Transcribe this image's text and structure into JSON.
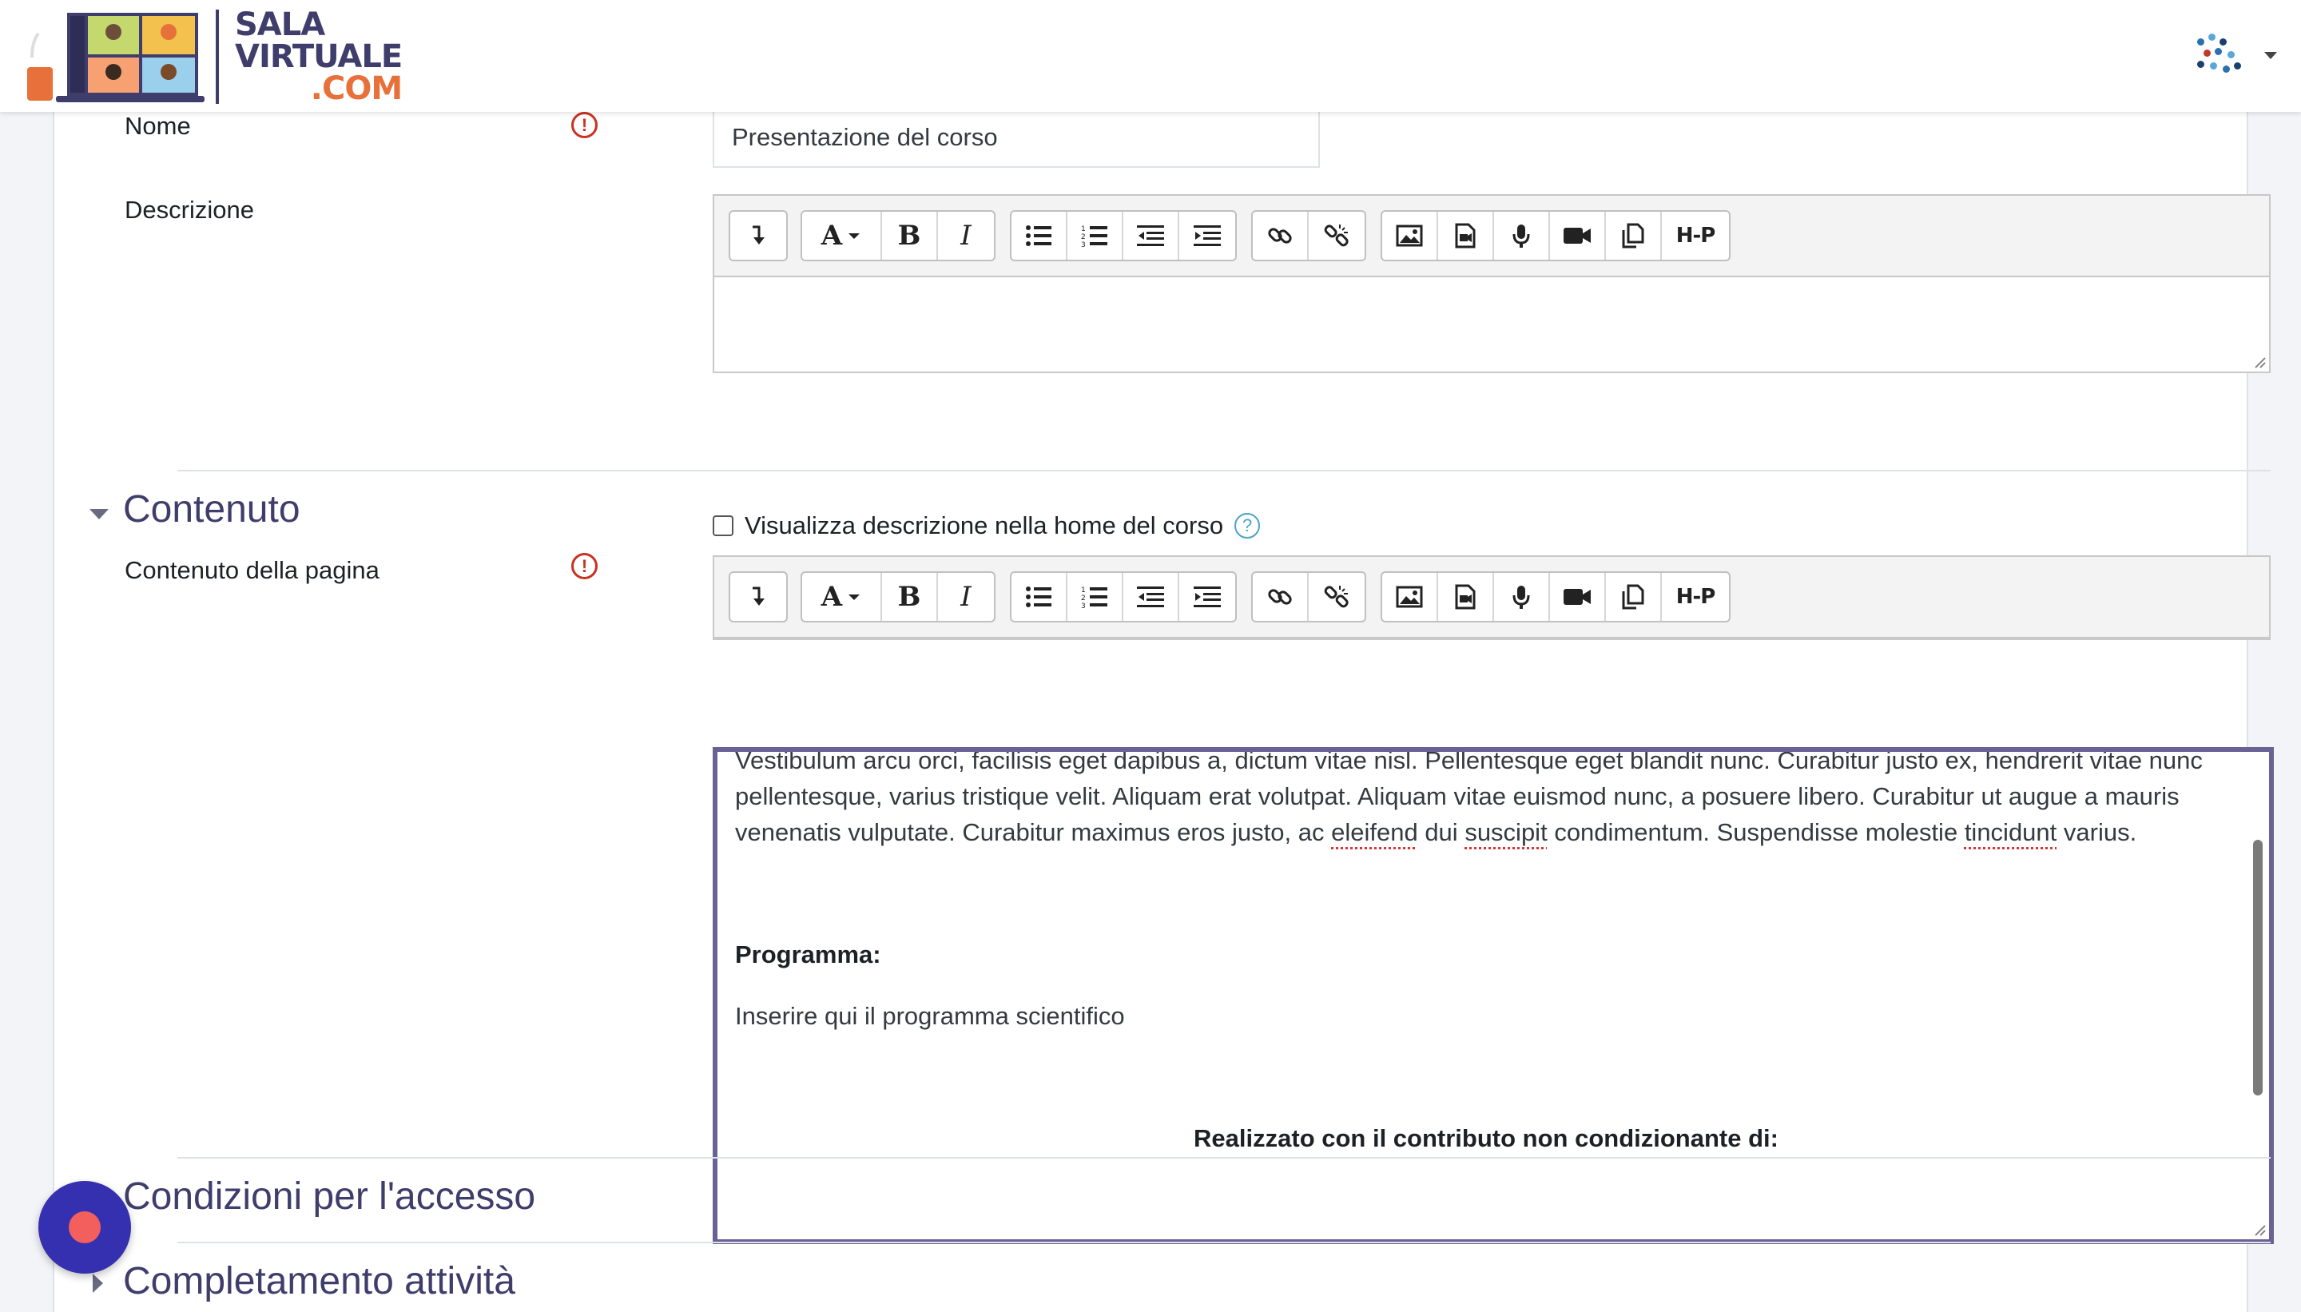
{
  "header": {
    "logo": {
      "line1": "SALA",
      "line2": "VIRTUALE",
      "line3": ".COM"
    }
  },
  "form": {
    "name": {
      "label": "Nome",
      "value": "Presentazione del corso"
    },
    "description": {
      "label": "Descrizione"
    },
    "show_description": {
      "label": "Visualizza descrizione nella home del corso",
      "help": "?"
    },
    "required_mark": "!"
  },
  "toolbar": {
    "icons": [
      "collapse-icon",
      "font-style-icon",
      "bold-icon",
      "italic-icon",
      "unordered-list-icon",
      "ordered-list-icon",
      "outdent-icon",
      "indent-icon",
      "link-icon",
      "unlink-icon",
      "image-icon",
      "media-icon",
      "record-audio-icon",
      "record-video-icon",
      "manage-files-icon",
      "h5p-icon"
    ],
    "font_glyph": "A",
    "bold_glyph": "B",
    "italic_glyph": "I",
    "h5p_label": "H-P"
  },
  "sections": {
    "contenuto": {
      "title": "Contenuto",
      "field_label": "Contenuto della pagina"
    },
    "condizioni": {
      "title": "Condizioni per l'accesso"
    },
    "completamento": {
      "title": "Completamento attività"
    }
  },
  "content": {
    "paragraph_1": "Vestibulum arcu orci, facilisis eget dapibus a, dictum vitae nisl. Pellentesque eget blandit nunc. Curabitur justo ex, hendrerit vitae nunc pellentesque, varius tristique velit. Aliquam erat volutpat. Aliquam vitae euismod nunc, a posuere libero. Curabitur ut augue a mauris venenatis vulputate. Curabitur maximus eros justo, ac",
    "paragraph_1_w1": "eleifend",
    "paragraph_1_mid": "dui",
    "paragraph_1_w2": "suscipit",
    "paragraph_1_cont": "condimentum. Suspendisse molestie",
    "paragraph_1_w3": "tincidunt",
    "paragraph_1_end": "varius.",
    "program_heading": "Programma:",
    "program_text": "Inserire qui il programma scientifico",
    "sponsor_text": "Realizzato con il contributo non condizionante di:"
  },
  "colors": {
    "accent": "#3e3d6b",
    "logo_orange": "#e8703a",
    "required": "#ca3120",
    "help": "#4aa3c6",
    "focus_border": "#6a6195",
    "fab": "#3530b0",
    "fab_dot": "#f25f5c"
  }
}
